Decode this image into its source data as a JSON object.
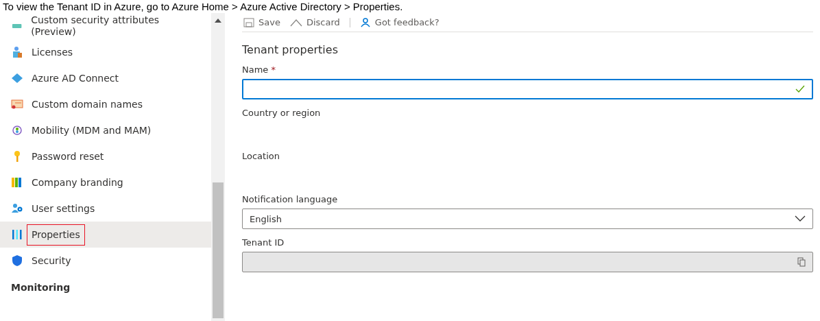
{
  "caption": "To view the Tenant ID in Azure, go to Azure Home > Azure Active Directory > Properties.",
  "sidebar": {
    "items": [
      {
        "label": "Custom security attributes (Preview)",
        "selected": false
      },
      {
        "label": "Licenses",
        "selected": false
      },
      {
        "label": "Azure AD Connect",
        "selected": false
      },
      {
        "label": "Custom domain names",
        "selected": false
      },
      {
        "label": "Mobility (MDM and MAM)",
        "selected": false
      },
      {
        "label": "Password reset",
        "selected": false
      },
      {
        "label": "Company branding",
        "selected": false
      },
      {
        "label": "User settings",
        "selected": false
      },
      {
        "label": "Properties",
        "selected": true
      },
      {
        "label": "Security",
        "selected": false
      }
    ],
    "section": "Monitoring"
  },
  "toolbar": [
    {
      "label": "Save"
    },
    {
      "label": "Discard"
    },
    {
      "label": "Got feedback?"
    }
  ],
  "form": {
    "title": "Tenant properties",
    "fields": [
      {
        "kind": "text",
        "label": "Name",
        "required_mark": "*",
        "valid": true
      },
      {
        "kind": "static",
        "label": "Country or region"
      },
      {
        "kind": "static",
        "label": "Location"
      },
      {
        "kind": "select",
        "label": "Notification language",
        "value": "English"
      },
      {
        "kind": "copy",
        "label": "Tenant ID",
        "disabled": true
      }
    ]
  }
}
